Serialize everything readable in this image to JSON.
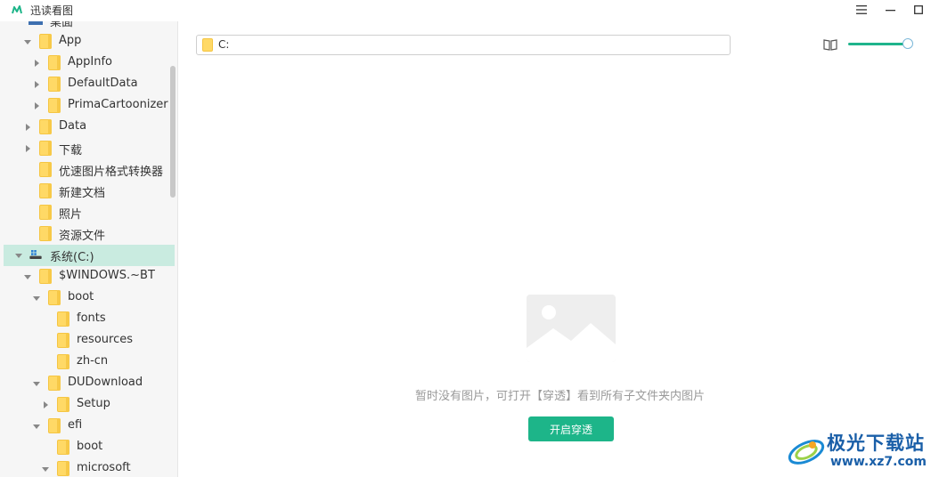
{
  "titlebar": {
    "title": "迅读看图",
    "menu_icon": "hamburger-icon",
    "minimize_icon": "minimize-icon",
    "maximize_icon": "maximize-icon"
  },
  "sidebar": {
    "tree": [
      {
        "label": "桌面",
        "type": "desktop",
        "expanded": false
      },
      {
        "label": "App",
        "type": "folder",
        "expanded": true
      },
      {
        "label": "AppInfo",
        "type": "folder",
        "expanded": false
      },
      {
        "label": "DefaultData",
        "type": "folder",
        "expanded": false
      },
      {
        "label": "PrimaCartoonizer",
        "type": "folder",
        "expanded": false
      },
      {
        "label": "Data",
        "type": "folder",
        "expanded": false
      },
      {
        "label": "下载",
        "type": "folder",
        "expanded": false
      },
      {
        "label": "优速图片格式转换器",
        "type": "folder"
      },
      {
        "label": "新建文档",
        "type": "folder"
      },
      {
        "label": "照片",
        "type": "folder"
      },
      {
        "label": "资源文件",
        "type": "folder"
      },
      {
        "label": "系统(C:)",
        "type": "drive",
        "expanded": true,
        "selected": true
      },
      {
        "label": "$WINDOWS.~BT",
        "type": "folder",
        "expanded": true
      },
      {
        "label": "boot",
        "type": "folder",
        "expanded": true
      },
      {
        "label": "fonts",
        "type": "folder"
      },
      {
        "label": "resources",
        "type": "folder"
      },
      {
        "label": "zh-cn",
        "type": "folder"
      },
      {
        "label": "DUDownload",
        "type": "folder",
        "expanded": true
      },
      {
        "label": "Setup",
        "type": "folder",
        "expanded": false
      },
      {
        "label": "efi",
        "type": "folder",
        "expanded": true
      },
      {
        "label": "boot",
        "type": "folder"
      },
      {
        "label": "microsoft",
        "type": "folder",
        "expanded": true
      }
    ]
  },
  "toolbar": {
    "path": "C:",
    "view_icon": "book-icon",
    "zoom_level": 0.95
  },
  "main": {
    "empty_message": "暂时没有图片，可打开【穿透】看到所有子文件夹内图片",
    "open_button_label": "开启穿透"
  },
  "watermark": {
    "title": "极光下载站",
    "url": "www.xz7.com"
  },
  "colors": {
    "accent": "#1db589",
    "selected_row": "#c9ebe0",
    "folder": "#ffd966",
    "watermark": "#1a5fa8"
  }
}
